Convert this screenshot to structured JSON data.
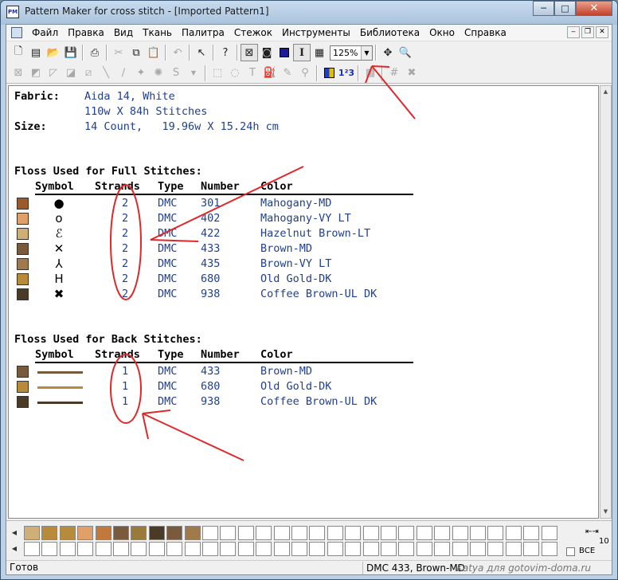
{
  "window": {
    "title": "Pattern Maker for cross stitch - [Imported Pattern1]",
    "app_icon_text": "PM",
    "minimize": "─",
    "maximize": "□",
    "close": "✕"
  },
  "menu": [
    "Файл",
    "Правка",
    "Вид",
    "Ткань",
    "Палитра",
    "Стежок",
    "Инструменты",
    "Библиотека",
    "Окно",
    "Справка"
  ],
  "mdi_buttons": [
    "‒",
    "❐",
    "✕"
  ],
  "toolbar1": {
    "zoom_value": "125%",
    "numbering_label": "1²3"
  },
  "document": {
    "fabric_label": "Fabric:",
    "fabric_value": "Aida 14, White",
    "stitches_value": "110w X 84h Stitches",
    "size_label": "Size:",
    "size_value": "14 Count,   19.96w X 15.24h cm",
    "full_section_title": "Floss Used for Full Stitches:",
    "back_section_title": "Floss Used for Back Stitches:",
    "columns": [
      "Symbol",
      "Strands",
      "Type",
      "Number",
      "Color"
    ],
    "full_stitches": [
      {
        "swatch": "#9a5a2a",
        "symbol": "●",
        "strands": "2",
        "type": "DMC",
        "number": "301",
        "color": "Mahogany-MD"
      },
      {
        "swatch": "#e0a06a",
        "symbol": "o",
        "strands": "2",
        "type": "DMC",
        "number": "402",
        "color": "Mahogany-VY LT"
      },
      {
        "swatch": "#cfae78",
        "symbol": "ℰ",
        "strands": "2",
        "type": "DMC",
        "number": "422",
        "color": "Hazelnut Brown-LT"
      },
      {
        "swatch": "#7a5a3c",
        "symbol": "✕",
        "strands": "2",
        "type": "DMC",
        "number": "433",
        "color": "Brown-MD"
      },
      {
        "swatch": "#a07a4a",
        "symbol": "⅄",
        "strands": "2",
        "type": "DMC",
        "number": "435",
        "color": "Brown-VY LT"
      },
      {
        "swatch": "#b88b3a",
        "symbol": "H",
        "strands": "2",
        "type": "DMC",
        "number": "680",
        "color": "Old Gold-DK"
      },
      {
        "swatch": "#4a3a28",
        "symbol": "✖",
        "strands": "2",
        "type": "DMC",
        "number": "938",
        "color": "Coffee Brown-UL DK"
      }
    ],
    "back_stitches": [
      {
        "swatch": "#7a5a3c",
        "line": "#7a5a3c",
        "strands": "1",
        "type": "DMC",
        "number": "433",
        "color": "Brown-MD"
      },
      {
        "swatch": "#b88b3a",
        "line": "#b88b3a",
        "strands": "1",
        "type": "DMC",
        "number": "680",
        "color": "Old Gold-DK"
      },
      {
        "swatch": "#4a3a28",
        "line": "#4a3a28",
        "strands": "1",
        "type": "DMC",
        "number": "938",
        "color": "Coffee Brown-UL DK"
      }
    ]
  },
  "palette": {
    "colors": [
      "#cfae78",
      "#b88b3a",
      "#b88b3a",
      "#e0a06a",
      "#c0793a",
      "#7a5a3c",
      "#9a7a3a",
      "#4a3a28",
      "#7a5a3c",
      "#a07a4a"
    ],
    "scroll_value": "10",
    "all_label": "ВСЕ"
  },
  "status": {
    "ready": "Готов",
    "current_floss": "DMC  433, Brown-MD",
    "watermark": "Katya для gotovim-doma.ru"
  }
}
